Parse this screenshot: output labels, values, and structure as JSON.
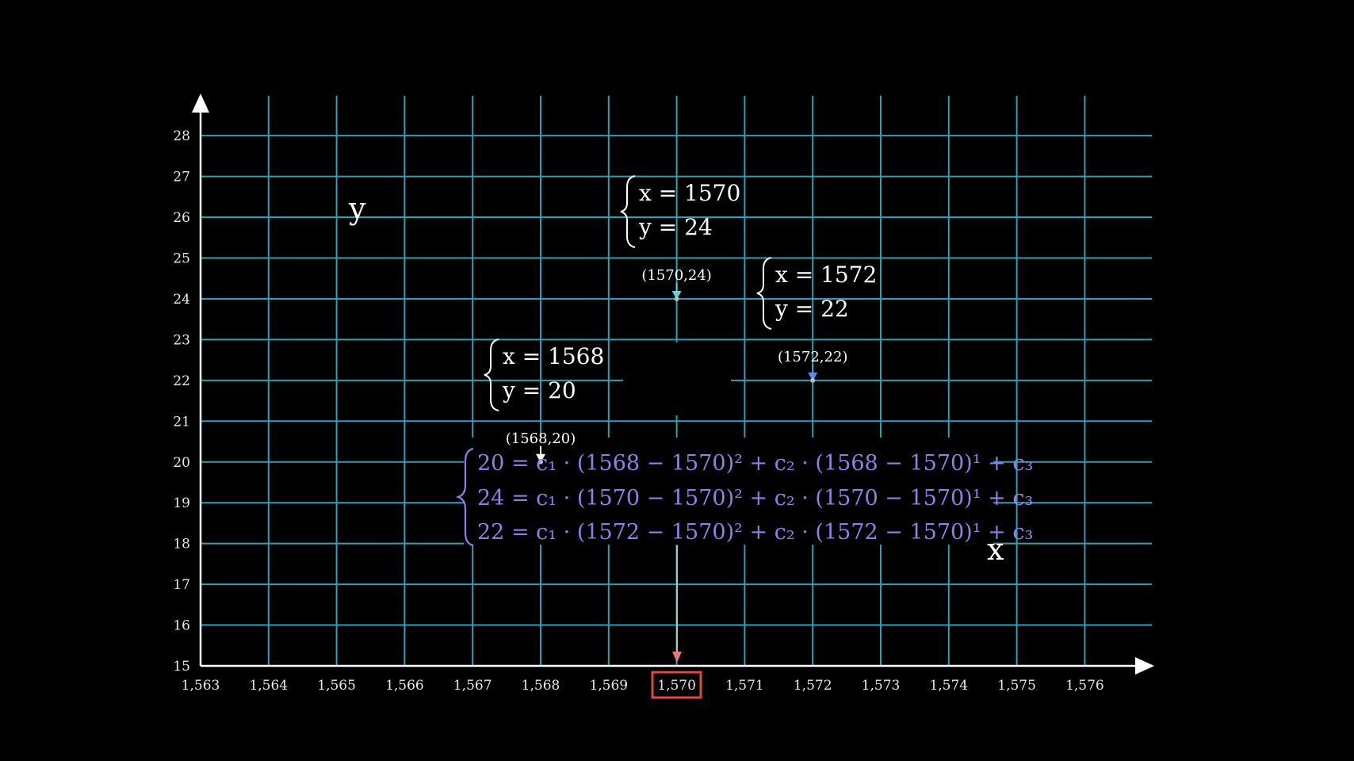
{
  "axes": {
    "x_label": "x",
    "y_label": "y",
    "x_ticks": [
      1563,
      1564,
      1565,
      1566,
      1567,
      1568,
      1569,
      1570,
      1571,
      1572,
      1573,
      1574,
      1575,
      1576
    ],
    "x_tick_labels": [
      "1,563",
      "1,564",
      "1,565",
      "1,566",
      "1,567",
      "1,568",
      "1,569",
      "1,570",
      "1,571",
      "1,572",
      "1,573",
      "1,574",
      "1,575",
      "1,576"
    ],
    "y_ticks": [
      15,
      16,
      17,
      18,
      19,
      20,
      21,
      22,
      23,
      24,
      25,
      26,
      27,
      28
    ],
    "y_tick_labels": [
      "15",
      "16",
      "17",
      "18",
      "19",
      "20",
      "21",
      "22",
      "23",
      "24",
      "25",
      "26",
      "27",
      "28"
    ],
    "xlim": [
      1563,
      1577
    ],
    "ylim": [
      15,
      29
    ],
    "highlighted_x_tick": "1,570"
  },
  "points": [
    {
      "x": 1568,
      "y": 20,
      "label": "(1568,20)",
      "color": "#ffffff"
    },
    {
      "x": 1570,
      "y": 24,
      "label": "(1570,24)",
      "color": "#5fd4e0"
    },
    {
      "x": 1572,
      "y": 22,
      "label": "(1572,22)",
      "color": "#5f8fe8"
    }
  ],
  "point_equations": [
    {
      "x_line": "x = 1570",
      "y_line": "y = 24"
    },
    {
      "x_line": "x = 1572",
      "y_line": "y = 22"
    },
    {
      "x_line": "x = 1568",
      "y_line": "y = 20"
    }
  ],
  "system": [
    "20 = c₁ · (1568 − 1570)² + c₂ · (1568 − 1570)¹ + c₃",
    "24 = c₁ · (1570 − 1570)² + c₂ · (1570 − 1570)¹ + c₃",
    "22 = c₁ · (1572 − 1570)² + c₂ · (1572 − 1570)¹ + c₃"
  ],
  "colors": {
    "background": "#000000",
    "grid": "#2f9fb3",
    "system_text": "#8f80e8",
    "highlight_box": "#e04848",
    "marker_arrow": "#e87878"
  }
}
